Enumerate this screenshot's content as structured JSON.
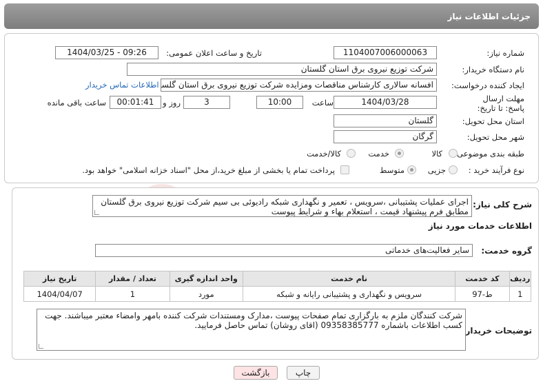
{
  "header": {
    "title": "جزئیات اطلاعات نیاز"
  },
  "fields": {
    "need_number_label": "شماره نیاز:",
    "need_number": "1104007006000063",
    "announce_label": "تاریخ و ساعت اعلان عمومی:",
    "announce_value": "1404/03/25 - 09:26",
    "buyer_org_label": "نام دستگاه خریدار:",
    "buyer_org": "شرکت توزیع نیروی برق استان گلستان",
    "requester_label": "ایجاد کننده درخواست:",
    "requester": "افسانه سالاری کارشناس مناقصات ومزایده شرکت توزیع نیروی برق استان گلستان",
    "contact_link": "اطلاعات تماس خریدار",
    "deadline_label": "مهلت ارسال پاسخ: تا تاریخ:",
    "deadline_date": "1404/03/28",
    "time_label": "ساعت",
    "deadline_time": "10:00",
    "days_value": "3",
    "days_label": "روز و",
    "remaining_time": "00:01:41",
    "remaining_label": "ساعت باقی مانده",
    "province_label": "استان محل تحویل:",
    "province": "گلستان",
    "city_label": "شهر محل تحویل:",
    "city": "گرگان",
    "category_label": "طبقه بندی موضوعی:",
    "category_options": [
      "کالا",
      "خدمت",
      "کالا/خدمت"
    ],
    "process_label": "نوع فرآیند خرید :",
    "process_options": [
      "جزیی",
      "متوسط"
    ],
    "payment_note": "پرداخت تمام یا بخشی از مبلغ خرید،از محل \"اسناد خزانه اسلامی\" خواهد بود."
  },
  "summary": {
    "label": "شرح کلی نیاز:",
    "text": "اجرای عملیات پشتیبانی ،سرویس ، تعمیر و نگهداری شبکه رادیوئی بی سیم شرکت توزیع نیروی برق گلستان مطابق فرم پیشنهاد قیمت ، استعلام بهاء و شرایط پیوست"
  },
  "services": {
    "section_title": "اطلاعات خدمات مورد نیاز",
    "group_label": "گروه خدمت:",
    "group_value": "سایر فعالیت‌های خدماتی",
    "columns": [
      "ردیف",
      "کد خدمت",
      "نام خدمت",
      "واحد اندازه گیری",
      "تعداد / مقدار",
      "تاریخ نیاز"
    ],
    "rows": [
      [
        "1",
        "ط-97",
        "سرویس و نگهداری و پشتیبانی رایانه و شبکه",
        "مورد",
        "1",
        "1404/04/07"
      ]
    ]
  },
  "buyer_notes": {
    "label": "توضیحات خریدار:",
    "text": "شرکت کنندگان ملزم به بارگزاری تمام صفحات پیوست ،مدارک ومستندات شرکت کننده بامهر وامضاء معتبر میباشند. جهت کسب اطلاعات باشماره  09358385777 (اقای روشان) تماس حاصل فرمایید."
  },
  "buttons": {
    "print": "چاپ",
    "back": "بازگشت"
  },
  "colors": {
    "header_bg": "#8a8a8a",
    "link": "#2367b6",
    "back_button_bg": "#fde3e3",
    "watermark": "#c0392b"
  }
}
